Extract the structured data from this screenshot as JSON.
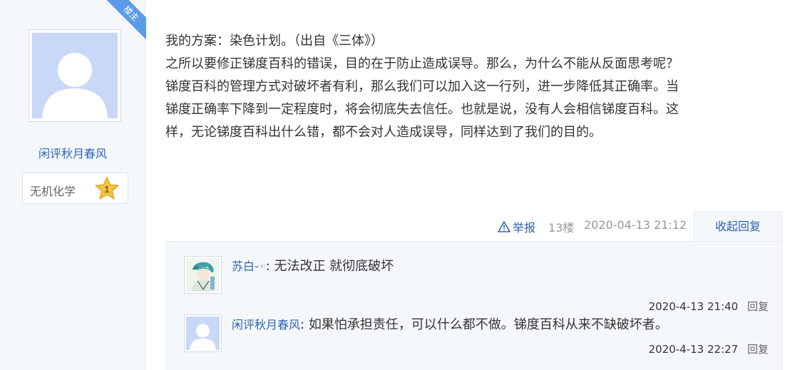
{
  "author": {
    "badge": "楼主",
    "name": "闲评秋月春风",
    "level_label": "无机化学",
    "level_number": "1"
  },
  "post": {
    "lines": [
      "我的方案：染色计划。（出自《三体》）",
      "之所以要修正锑度百科的错误，目的在于防止造成误导。那么，为什么不能从反面思考呢？",
      "锑度百科的管理方式对破坏者有利，那么我们可以加入这一行列，进一步降低其正确率。当",
      "锑度正确率下降到一定程度时，将会彻底失去信任。也就是说，没有人会相信锑度百科。这",
      "样，无论锑度百科出什么错，都不会对人造成误导，同样达到了我们的目的。"
    ],
    "report_label": "举报",
    "floor": "13楼",
    "time": "2020-04-13 21:12",
    "collapse_label": "收起回复"
  },
  "replies": [
    {
      "user": "苏白-",
      "user_suffix": "☜",
      "separator": ": ",
      "text": "无法改正 就彻底破坏",
      "time": "2020-4-13 21:40",
      "reply_label": "回复"
    },
    {
      "user": "闲评秋月春风",
      "separator": ": ",
      "text": "如果怕承担责任，可以什么都不做。锑度百科从来不缺破坏者。",
      "time": "2020-4-13 22:27",
      "reply_label": "回复"
    }
  ],
  "colors": {
    "link": "#2d64b3",
    "badge": "#5b9be8",
    "sidebar_bg": "#f5f8fb"
  }
}
